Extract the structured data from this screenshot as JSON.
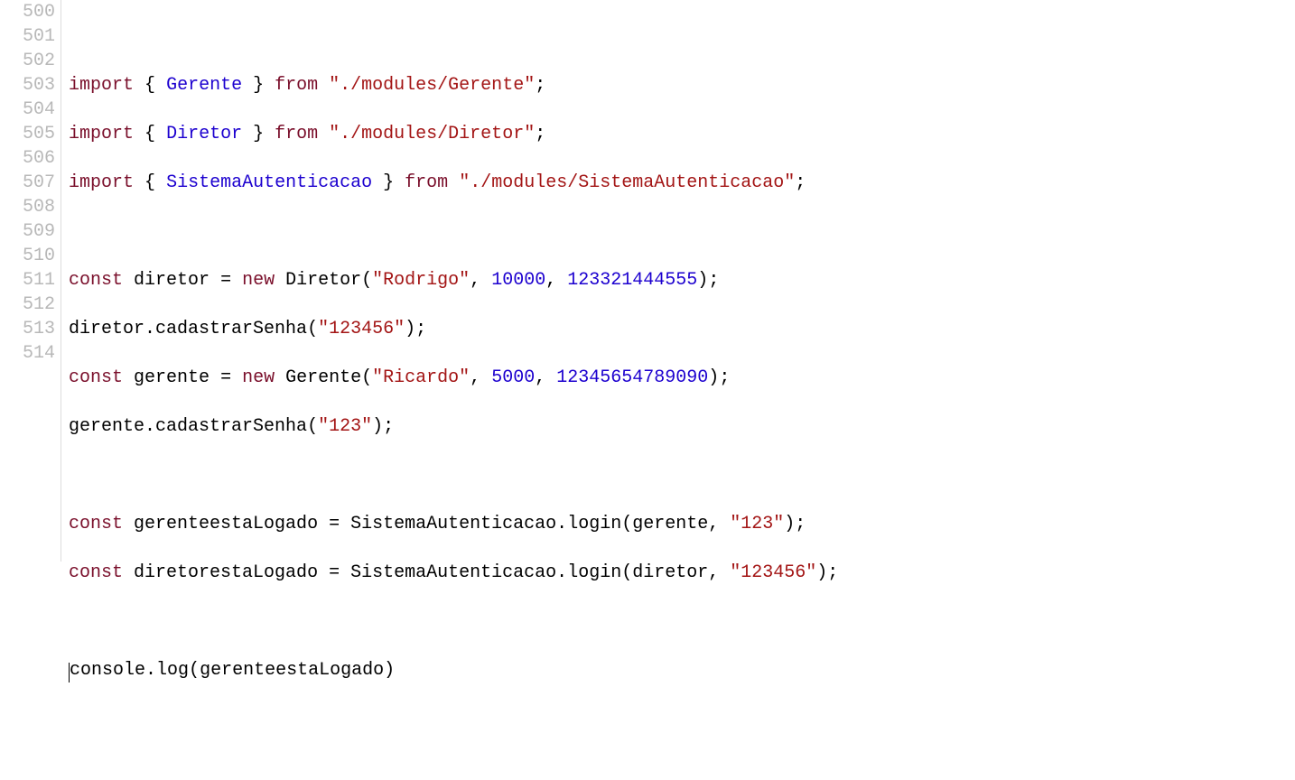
{
  "gutter": {
    "lines": [
      "500",
      "501",
      "502",
      "503",
      "504",
      "505",
      "506",
      "507",
      "508",
      "509",
      "510",
      "511",
      "512",
      "513",
      "514"
    ]
  },
  "code": {
    "l500": "    ",
    "kw_import": "import",
    "kw_from": "from",
    "kw_const": "const",
    "kw_new": "new",
    "brace_open": "{",
    "brace_close": "}",
    "semi": ";",
    "comma": ",",
    "paren_open": "(",
    "paren_close": ")",
    "eq": "=",
    "dot": ".",
    "t_Gerente": "Gerente",
    "t_Diretor": "Diretor",
    "t_SistemaAutenticacao": "SistemaAutenticacao",
    "s_modGerente": "\"./modules/Gerente\"",
    "s_modDiretor": "\"./modules/Diretor\"",
    "s_modSistema": "\"./modules/SistemaAutenticacao\"",
    "id_diretor": "diretor",
    "id_gerente": "gerente",
    "id_gerenteestaLogado": "gerenteestaLogado",
    "id_diretorestaLogado": "diretorestaLogado",
    "id_console": "console",
    "id_log": "log",
    "id_login": "login",
    "id_cadastrarSenha": "cadastrarSenha",
    "s_Rodrigo": "\"Rodrigo\"",
    "s_Ricardo": "\"Ricardo\"",
    "s_123456": "\"123456\"",
    "s_123": "\"123\"",
    "n_10000": "10000",
    "n_5000": "5000",
    "n_123321444555": "123321444555",
    "n_12345654789090": "12345654789090"
  }
}
